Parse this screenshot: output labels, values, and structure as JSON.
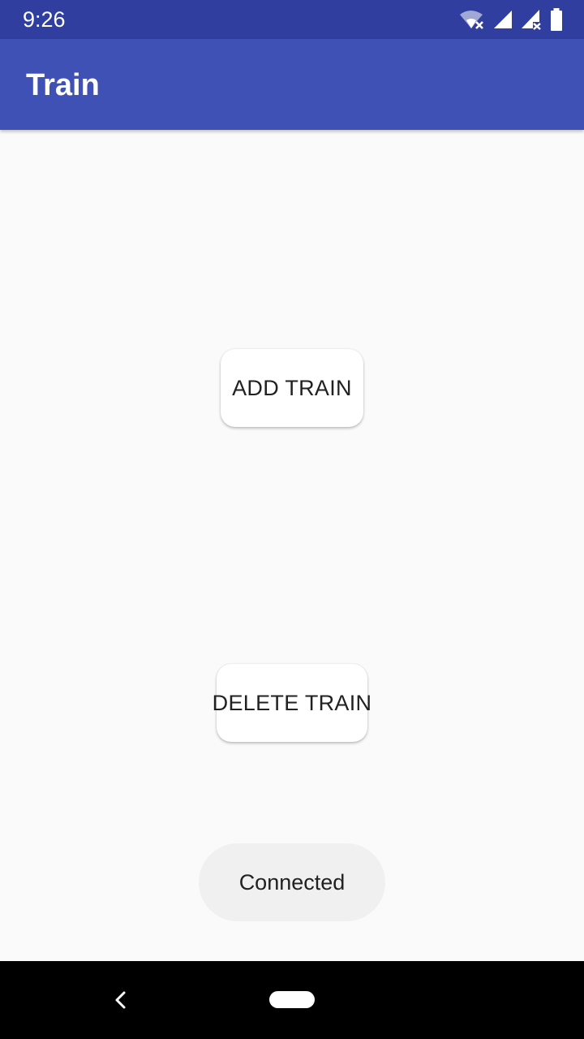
{
  "status_bar": {
    "time": "9:26",
    "icons": [
      "wifi-off-icon",
      "cell-signal-icon",
      "cell-signal-no-data-icon",
      "battery-icon"
    ],
    "color": "#303f9f"
  },
  "app_bar": {
    "title": "Train",
    "color": "#3f51b5"
  },
  "main": {
    "add_train_label": "ADD TRAIN",
    "delete_train_label": "DELETE TRAIN"
  },
  "toast": {
    "message": "Connected"
  },
  "nav_bar": {
    "icons": [
      "back-icon",
      "home-pill-icon"
    ]
  }
}
